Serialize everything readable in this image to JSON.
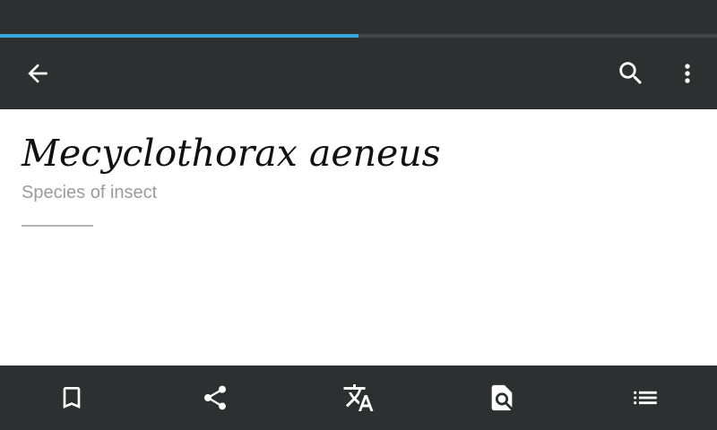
{
  "page": {
    "title": "Mecyclothorax aeneus",
    "description": "Species of insect"
  },
  "progress": {
    "loaded_fraction": 0.5,
    "color": "#33a9dc"
  },
  "toolbar": {
    "back_icon": "arrow-left-icon",
    "search_icon": "search-icon",
    "more_icon": "more-vertical-icon"
  },
  "bottom_bar": {
    "items": [
      {
        "icon": "bookmark-icon"
      },
      {
        "icon": "share-icon"
      },
      {
        "icon": "translate-icon"
      },
      {
        "icon": "find-in-page-icon"
      },
      {
        "icon": "table-of-contents-icon"
      }
    ]
  },
  "colors": {
    "bar_background": "#2e2f31",
    "accent": "#33a9dc",
    "title_text": "#111111",
    "subtitle_text": "#9a9b9d"
  }
}
